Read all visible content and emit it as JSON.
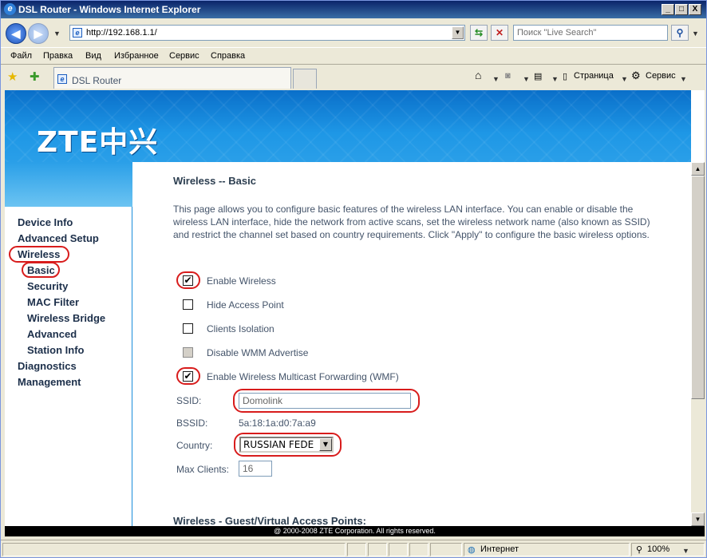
{
  "window": {
    "title": "DSL Router - Windows Internet Explorer",
    "min": "_",
    "max": "□",
    "close": "X"
  },
  "address": {
    "url": "http://192.168.1.1/",
    "search_placeholder": "Поиск \"Live Search\""
  },
  "menu": [
    "Файл",
    "Правка",
    "Вид",
    "Избранное",
    "Сервис",
    "Справка"
  ],
  "tab": {
    "label": "DSL Router"
  },
  "tools": {
    "page": "Страница",
    "service": "Сервис"
  },
  "brand": {
    "logo": "ZTE中兴"
  },
  "sidebar": {
    "items": [
      {
        "label": "Device Info"
      },
      {
        "label": "Advanced Setup"
      },
      {
        "label": "Wireless"
      },
      {
        "label": "Basic"
      },
      {
        "label": "Security"
      },
      {
        "label": "MAC Filter"
      },
      {
        "label": "Wireless Bridge"
      },
      {
        "label": "Advanced"
      },
      {
        "label": "Station Info"
      },
      {
        "label": "Diagnostics"
      },
      {
        "label": "Management"
      }
    ]
  },
  "main": {
    "title": "Wireless -- Basic",
    "description": "This page allows you to configure basic features of the wireless LAN interface. You can enable or disable the wireless LAN interface, hide the network from active scans, set the wireless network name (also known as SSID) and restrict the channel set based on country requirements. Click \"Apply\" to configure the basic wireless options.",
    "options": [
      {
        "label": "Enable Wireless",
        "checked": true
      },
      {
        "label": "Hide Access Point",
        "checked": false
      },
      {
        "label": "Clients Isolation",
        "checked": false
      },
      {
        "label": "Disable WMM Advertise",
        "checked": false,
        "disabled": true
      },
      {
        "label": "Enable Wireless Multicast Forwarding (WMF)",
        "checked": true
      }
    ],
    "ssid_label": "SSID:",
    "ssid_value": "Domolink",
    "bssid_label": "BSSID:",
    "bssid_value": "5a:18:1a:d0:7a:a9",
    "country_label": "Country:",
    "country_value": "RUSSIAN FEDE",
    "maxclients_label": "Max Clients:",
    "maxclients_value": "16",
    "section2": "Wireless - Guest/Virtual Access Points:"
  },
  "footer": "@ 2000-2008 ZTE Corporation. All rights reserved.",
  "status": {
    "zone": "Интернет",
    "zoom": "100%"
  },
  "colors": {
    "highlight": "#d81c1c",
    "brand_blue": "#1b8ddb"
  }
}
